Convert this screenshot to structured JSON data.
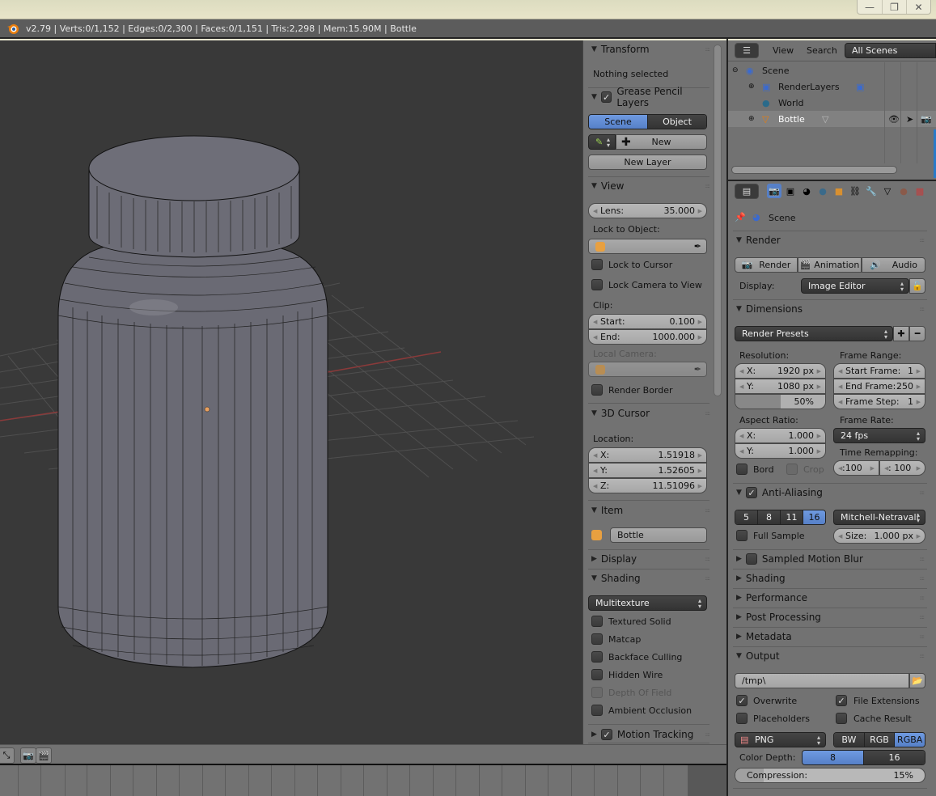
{
  "window": {
    "minimize": "—",
    "restore": "❐",
    "close": "✕"
  },
  "info_bar": {
    "text": "v2.79 | Verts:0/1,152 | Edges:0/2,300 | Faces:0/1,151 | Tris:2,298 | Mem:15.90M | Bottle"
  },
  "n_panel": {
    "transform": {
      "title": "Transform",
      "status": "Nothing selected"
    },
    "grease_pencil": {
      "title": "Grease Pencil Layers",
      "checked": true,
      "scene_label": "Scene",
      "object_label": "Object",
      "new_label": "New",
      "new_layer_label": "New Layer"
    },
    "view": {
      "title": "View",
      "lens_label": "Lens:",
      "lens_value": "35.000",
      "lock_to_object": "Lock to Object:",
      "lock_to_cursor": "Lock to Cursor",
      "lock_camera": "Lock Camera to View",
      "clip": "Clip:",
      "start_label": "Start:",
      "start_value": "0.100",
      "end_label": "End:",
      "end_value": "1000.000",
      "local_camera": "Local Camera:",
      "render_border": "Render Border"
    },
    "cursor": {
      "title": "3D Cursor",
      "location": "Location:",
      "x_label": "X:",
      "x": "1.51918",
      "y_label": "Y:",
      "y": "1.52605",
      "z_label": "Z:",
      "z": "11.51096"
    },
    "item": {
      "title": "Item",
      "name": "Bottle"
    },
    "display": {
      "title": "Display"
    },
    "shading": {
      "title": "Shading",
      "mode": "Multitexture",
      "options": [
        "Textured Solid",
        "Matcap",
        "Backface Culling",
        "Hidden Wire",
        "Depth Of Field",
        "Ambient Occlusion"
      ]
    },
    "motion_tracking": {
      "title": "Motion Tracking",
      "checked": true
    }
  },
  "outliner": {
    "view": "View",
    "search": "Search",
    "scenes": "All Scenes",
    "items": [
      {
        "name": "Scene"
      },
      {
        "name": "RenderLayers"
      },
      {
        "name": "World"
      },
      {
        "name": "Bottle"
      }
    ]
  },
  "properties": {
    "context": "Scene",
    "render": {
      "title": "Render",
      "render_btn": "Render",
      "animation_btn": "Animation",
      "audio_btn": "Audio",
      "display_label": "Display:",
      "display_value": "Image Editor"
    },
    "dimensions": {
      "title": "Dimensions",
      "presets": "Render Presets",
      "resolution": "Resolution:",
      "res_x_label": "X:",
      "res_x": "1920 px",
      "res_y_label": "Y:",
      "res_y": "1080 px",
      "res_pct": "50%",
      "res_pct_value": 50,
      "frame_range": "Frame Range:",
      "start_frame_label": "Start Frame:",
      "start_frame": "1",
      "end_frame_label": "End Frame:",
      "end_frame": "250",
      "frame_step_label": "Frame Step:",
      "frame_step": "1",
      "aspect": "Aspect Ratio:",
      "asp_x_label": "X:",
      "asp_x": "1.000",
      "asp_y_label": "Y:",
      "asp_y": "1.000",
      "frame_rate": "Frame Rate:",
      "fps": "24 fps",
      "time_remap": "Time Remapping:",
      "remap_old": ":100",
      "remap_new": ": 100",
      "bord": "Bord",
      "crop": "Crop"
    },
    "anti_aliasing": {
      "title": "Anti-Aliasing",
      "checked": true,
      "samples": [
        "5",
        "8",
        "11",
        "16"
      ],
      "selected": "16",
      "filter": "Mitchell-Netravali",
      "full_sample": "Full Sample",
      "size_label": "Size:",
      "size": "1.000 px"
    },
    "collapsed": [
      "Sampled Motion Blur",
      "Shading",
      "Performance",
      "Post Processing",
      "Metadata"
    ],
    "output": {
      "title": "Output",
      "path": "/tmp\\",
      "overwrite": "Overwrite",
      "file_ext": "File Extensions",
      "placeholders": "Placeholders",
      "cache": "Cache Result",
      "format": "PNG",
      "color_modes": [
        "BW",
        "RGB",
        "RGBA"
      ],
      "color_selected": "RGBA",
      "depth_label": "Color Depth:",
      "depths": [
        "8",
        "16"
      ],
      "depth_selected": "8",
      "compression_label": "Compression:",
      "compression": "15%",
      "compression_value": 15
    }
  }
}
